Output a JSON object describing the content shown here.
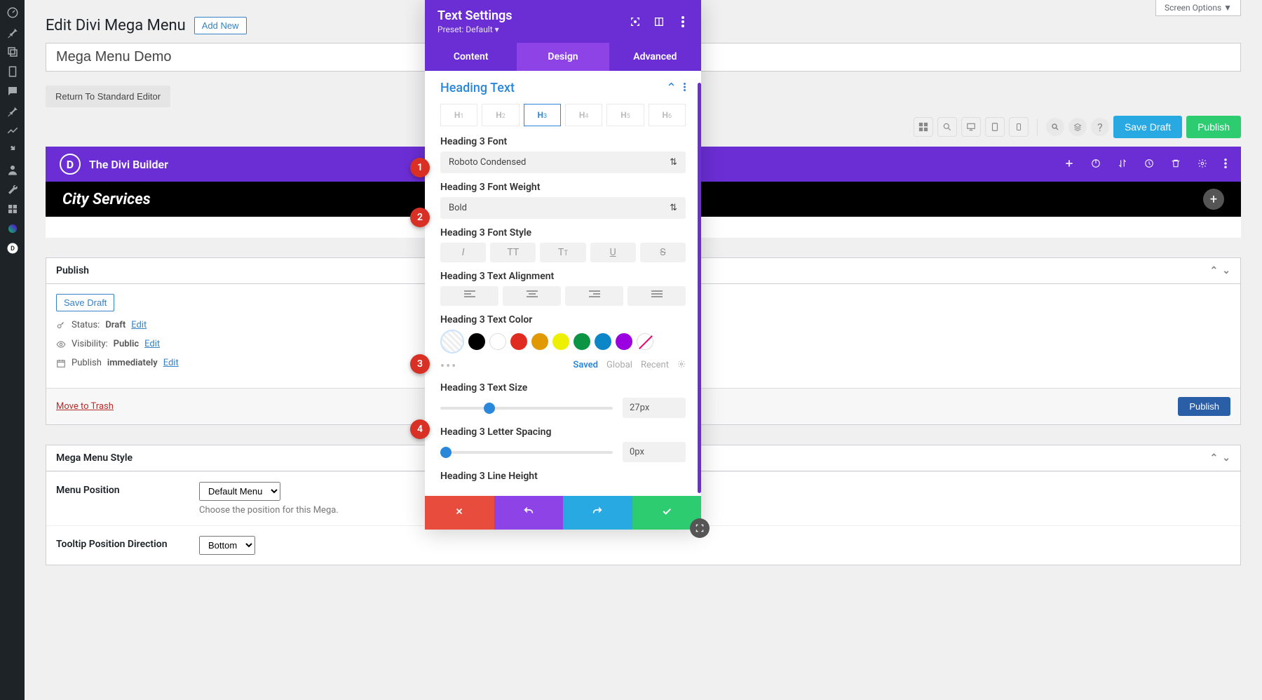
{
  "screen_options": "Screen Options ▼",
  "page_title": "Edit Divi Mega Menu",
  "add_new": "Add New",
  "post_title": "Mega Menu Demo",
  "return_btn": "Return To Standard Editor",
  "toolbar": {
    "save_draft": "Save Draft",
    "publish": "Publish"
  },
  "divi_bar": {
    "title": "The Divi Builder"
  },
  "black_bar": {
    "heading": "City Services"
  },
  "publish_box": {
    "title": "Publish",
    "save_draft": "Save Draft",
    "status_label": "Status:",
    "status_value": "Draft",
    "status_edit": "Edit",
    "visibility_label": "Visibility:",
    "visibility_value": "Public",
    "visibility_edit": "Edit",
    "publish_label": "Publish",
    "publish_value": "immediately",
    "publish_edit": "Edit",
    "move_trash": "Move to Trash",
    "publish_btn": "Publish"
  },
  "mega_style_box": {
    "title": "Mega Menu Style",
    "menu_position_label": "Menu Position",
    "menu_position_value": "Default Menu",
    "menu_position_help": "Choose the position for this Mega.",
    "tooltip_label": "Tooltip Position Direction",
    "tooltip_value": "Bottom"
  },
  "panel": {
    "title": "Text Settings",
    "preset": "Preset: Default ▾",
    "tabs": {
      "content": "Content",
      "design": "Design",
      "advanced": "Advanced"
    },
    "section": "Heading Text",
    "headings": [
      "H₁",
      "H₂",
      "H₃",
      "H₄",
      "H₅",
      "H₆"
    ],
    "active_heading": 2,
    "font_label": "Heading 3 Font",
    "font_value": "Roboto Condensed",
    "weight_label": "Heading 3 Font Weight",
    "weight_value": "Bold",
    "style_label": "Heading 3 Font Style",
    "align_label": "Heading 3 Text Alignment",
    "color_label": "Heading 3 Text Color",
    "color_tabs": {
      "saved": "Saved",
      "global": "Global",
      "recent": "Recent"
    },
    "size_label": "Heading 3 Text Size",
    "size_value": "27px",
    "spacing_label": "Heading 3 Letter Spacing",
    "spacing_value": "0px",
    "lineheight_label": "Heading 3 Line Height",
    "colors": [
      "#000000",
      "#ffffff",
      "#e02b20",
      "#e09900",
      "#edf000",
      "#0b9444",
      "#0d86c8",
      "#9b00e0"
    ]
  },
  "markers": {
    "m1": "1",
    "m2": "2",
    "m3": "3",
    "m4": "4"
  }
}
